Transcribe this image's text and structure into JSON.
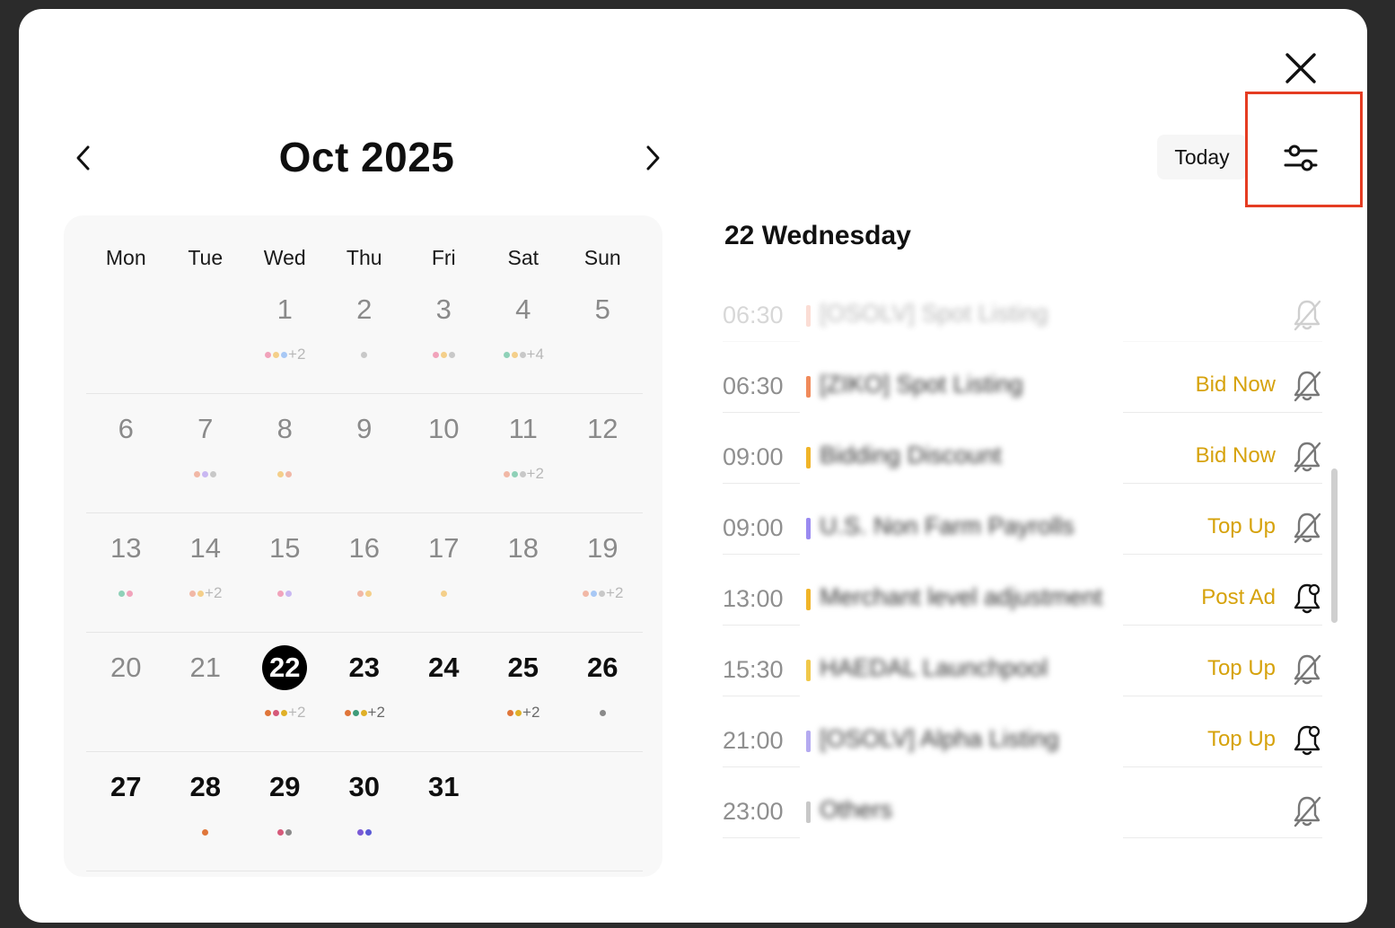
{
  "calendar": {
    "month_title": "Oct 2025",
    "weekdays": [
      "Mon",
      "Tue",
      "Wed",
      "Thu",
      "Fri",
      "Sat",
      "Sun"
    ],
    "weeks": [
      [
        {
          "num": "",
          "dots": [],
          "more": ""
        },
        {
          "num": "",
          "dots": [],
          "more": ""
        },
        {
          "num": "1",
          "dots": [
            "#f1a3bb",
            "#f4cf8a",
            "#a8c8f5"
          ],
          "more": "+2"
        },
        {
          "num": "2",
          "dots": [
            "#c8c8c8"
          ],
          "more": ""
        },
        {
          "num": "3",
          "dots": [
            "#f1a3bb",
            "#f4cf8a",
            "#c8c8c8"
          ],
          "more": ""
        },
        {
          "num": "4",
          "dots": [
            "#8fd1b8",
            "#f4cf8a",
            "#c8c8c8"
          ],
          "more": "+4"
        },
        {
          "num": "5",
          "dots": [],
          "more": ""
        }
      ],
      [
        {
          "num": "6",
          "dots": [],
          "more": ""
        },
        {
          "num": "7",
          "dots": [
            "#f1b8a6",
            "#c9b8f2",
            "#c8c8c8"
          ],
          "more": ""
        },
        {
          "num": "8",
          "dots": [
            "#f4cf8a",
            "#f1b8a6"
          ],
          "more": ""
        },
        {
          "num": "9",
          "dots": [],
          "more": ""
        },
        {
          "num": "10",
          "dots": [],
          "more": ""
        },
        {
          "num": "11",
          "dots": [
            "#f1b8a6",
            "#8fd1b8",
            "#c8c8c8"
          ],
          "more": "+2"
        },
        {
          "num": "12",
          "dots": [],
          "more": ""
        }
      ],
      [
        {
          "num": "13",
          "dots": [
            "#8fd1b8",
            "#f1a3bb"
          ],
          "more": ""
        },
        {
          "num": "14",
          "dots": [
            "#f1b8a6",
            "#f4cf8a"
          ],
          "more": "+2"
        },
        {
          "num": "15",
          "dots": [
            "#f1a3bb",
            "#c9b8f2"
          ],
          "more": ""
        },
        {
          "num": "16",
          "dots": [
            "#f1b8a6",
            "#f4cf8a"
          ],
          "more": ""
        },
        {
          "num": "17",
          "dots": [
            "#f4cf8a"
          ],
          "more": ""
        },
        {
          "num": "18",
          "dots": [],
          "more": ""
        },
        {
          "num": "19",
          "dots": [
            "#f1b8a6",
            "#a8c8f5",
            "#c8c8c8"
          ],
          "more": "+2"
        }
      ],
      [
        {
          "num": "20",
          "dots": [],
          "more": ""
        },
        {
          "num": "21",
          "dots": [],
          "more": ""
        },
        {
          "num": "22",
          "dots": [
            "#e0763a",
            "#d65a7a",
            "#e0b028"
          ],
          "more": "+2",
          "selected": true
        },
        {
          "num": "23",
          "dots": [
            "#e0763a",
            "#3f9c7a",
            "#e0b028"
          ],
          "more": "+2",
          "future": true
        },
        {
          "num": "24",
          "dots": [],
          "more": "",
          "future": true
        },
        {
          "num": "25",
          "dots": [
            "#e0763a",
            "#e0b028"
          ],
          "more": "+2",
          "future": true
        },
        {
          "num": "26",
          "dots": [
            "#8a8a8a"
          ],
          "more": "",
          "future": true
        }
      ],
      [
        {
          "num": "27",
          "dots": [],
          "more": "",
          "future": true
        },
        {
          "num": "28",
          "dots": [
            "#e0763a"
          ],
          "more": "",
          "future": true
        },
        {
          "num": "29",
          "dots": [
            "#d65a7a",
            "#8a8a8a"
          ],
          "more": "",
          "future": true
        },
        {
          "num": "30",
          "dots": [
            "#7a5ad6",
            "#5a5ad6"
          ],
          "more": "",
          "future": true
        },
        {
          "num": "31",
          "dots": [],
          "more": "",
          "future": true
        },
        {
          "num": "",
          "dots": [],
          "more": ""
        },
        {
          "num": "",
          "dots": [],
          "more": ""
        }
      ]
    ]
  },
  "header": {
    "today_label": "Today"
  },
  "schedule": {
    "day_heading": "22 Wednesday",
    "events": [
      {
        "time": "06:30",
        "title": "[OSOLV] Spot Listing",
        "action": "",
        "bar_color": "#f4a08a",
        "bell": "off",
        "faded": true
      },
      {
        "time": "06:30",
        "title": "[ZIKO] Spot Listing",
        "action": "Bid Now",
        "bar_color": "#f08a5a",
        "bell": "off"
      },
      {
        "time": "09:00",
        "title": "Bidding Discount",
        "action": "Bid Now",
        "bar_color": "#f0b428",
        "bell": "off"
      },
      {
        "time": "09:00",
        "title": "U.S. Non Farm Payrolls",
        "action": "Top Up",
        "bar_color": "#9a8af0",
        "bell": "off"
      },
      {
        "time": "13:00",
        "title": "Merchant level adjustment",
        "action": "Post Ad",
        "bar_color": "#f0b428",
        "bell": "on"
      },
      {
        "time": "15:30",
        "title": "HAEDAL Launchpool",
        "action": "Top Up",
        "bar_color": "#f0c84a",
        "bell": "off"
      },
      {
        "time": "21:00",
        "title": "[OSOLV] Alpha Listing",
        "action": "Top Up",
        "bar_color": "#b4aaf0",
        "bell": "on"
      },
      {
        "time": "23:00",
        "title": "Others",
        "action": "",
        "bar_color": "#c8c8c8",
        "bell": "off"
      }
    ]
  },
  "colors": {
    "accent": "#d6a20b",
    "highlight_box": "#e53c22",
    "selected_day_bg": "#000000"
  },
  "icons": {
    "close": "close-icon",
    "prev": "chevron-left-icon",
    "next": "chevron-right-icon",
    "filter": "sliders-icon",
    "bell_off": "bell-off-icon",
    "bell_on": "bell-add-icon"
  }
}
